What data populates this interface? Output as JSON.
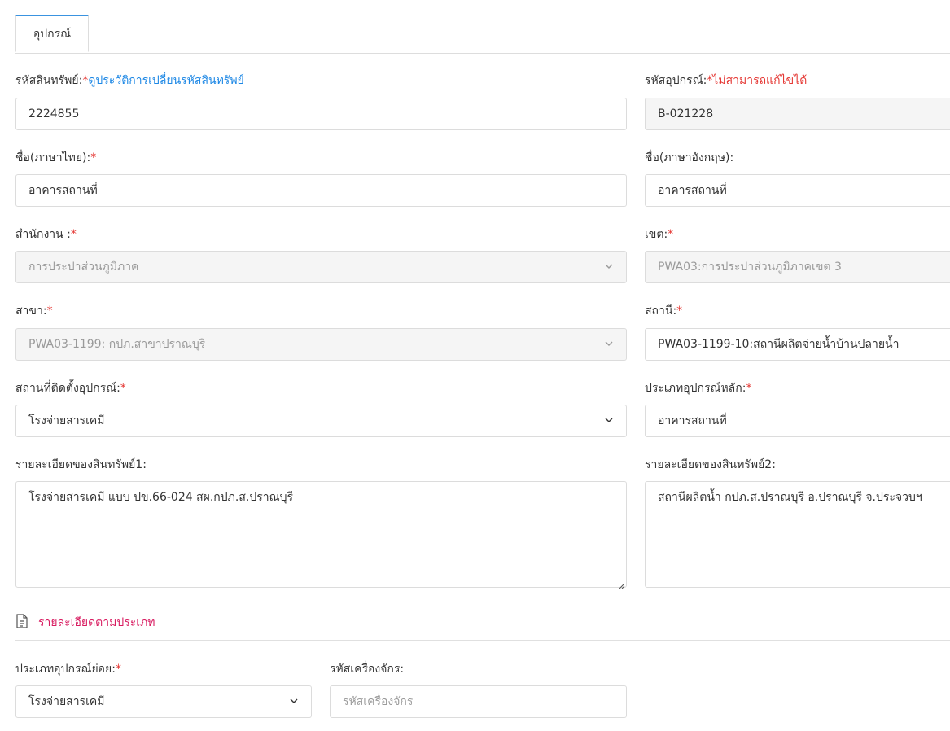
{
  "tabs": [
    {
      "label": "อุปกรณ์",
      "active": true
    }
  ],
  "asset_code": {
    "label": "รหัสสินทรัพย์:",
    "required": "*",
    "history_link": "ดูประวัติการเปลี่ยนรหัสสินทรัพย์",
    "value": "2224855"
  },
  "equipment_code": {
    "label": "รหัสอุปกรณ์:",
    "note": "*ไม่สามารถแก้ไขได้",
    "value": "B-021228"
  },
  "name_th": {
    "label": "ชื่อ(ภาษาไทย):",
    "required": "*",
    "value": "อาคารสถานที่"
  },
  "name_en": {
    "label": "ชื่อ(ภาษาอังกฤษ):",
    "value": "อาคารสถานที่"
  },
  "office": {
    "label": "สำนักงาน :",
    "required": "*",
    "value": "การประปาส่วนภูมิภาค"
  },
  "zone": {
    "label": "เขต:",
    "required": "*",
    "value": "PWA03:การประปาส่วนภูมิภาคเขต 3"
  },
  "branch": {
    "label": "สาขา:",
    "required": "*",
    "value": "PWA03-1199: กปภ.สาขาปราณบุรี"
  },
  "station": {
    "label": "สถานี:",
    "required": "*",
    "value": "PWA03-1199-10:สถานีผลิตจ่ายน้ำบ้านปลายน้ำ"
  },
  "install_location": {
    "label": "สถานที่ติดตั้งอุปกรณ์:",
    "required": "*",
    "value": "โรงจ่ายสารเคมี"
  },
  "main_type": {
    "label": "ประเภทอุปกรณ์หลัก:",
    "required": "*",
    "value": "อาคารสถานที่"
  },
  "detail1": {
    "label": "รายละเอียดของสินทรัพย์1:",
    "value": "โรงจ่ายสารเคมี แบบ ปข.66-024 สผ.กปภ.ส.ปราณบุรี"
  },
  "detail2": {
    "label": "รายละเอียดของสินทรัพย์2:",
    "value": "สถานีผลิตน้ำ กปภ.ส.ปราณบุรี อ.ปราณบุรี จ.ประจวบฯ"
  },
  "section": {
    "title": "รายละเอียดตามประเภท",
    "icon": "document-icon"
  },
  "sub_type": {
    "label": "ประเภทอุปกรณ์ย่อย:",
    "required": "*",
    "value": "โรงจ่ายสารเคมี"
  },
  "machine_code": {
    "label": "รหัสเครื่องจักร:",
    "placeholder": "รหัสเครื่องจักร",
    "value": ""
  },
  "colors": {
    "accent": "#3a93e0",
    "required": "#e53935",
    "link": "#1e88e5",
    "section": "#d81b60"
  }
}
